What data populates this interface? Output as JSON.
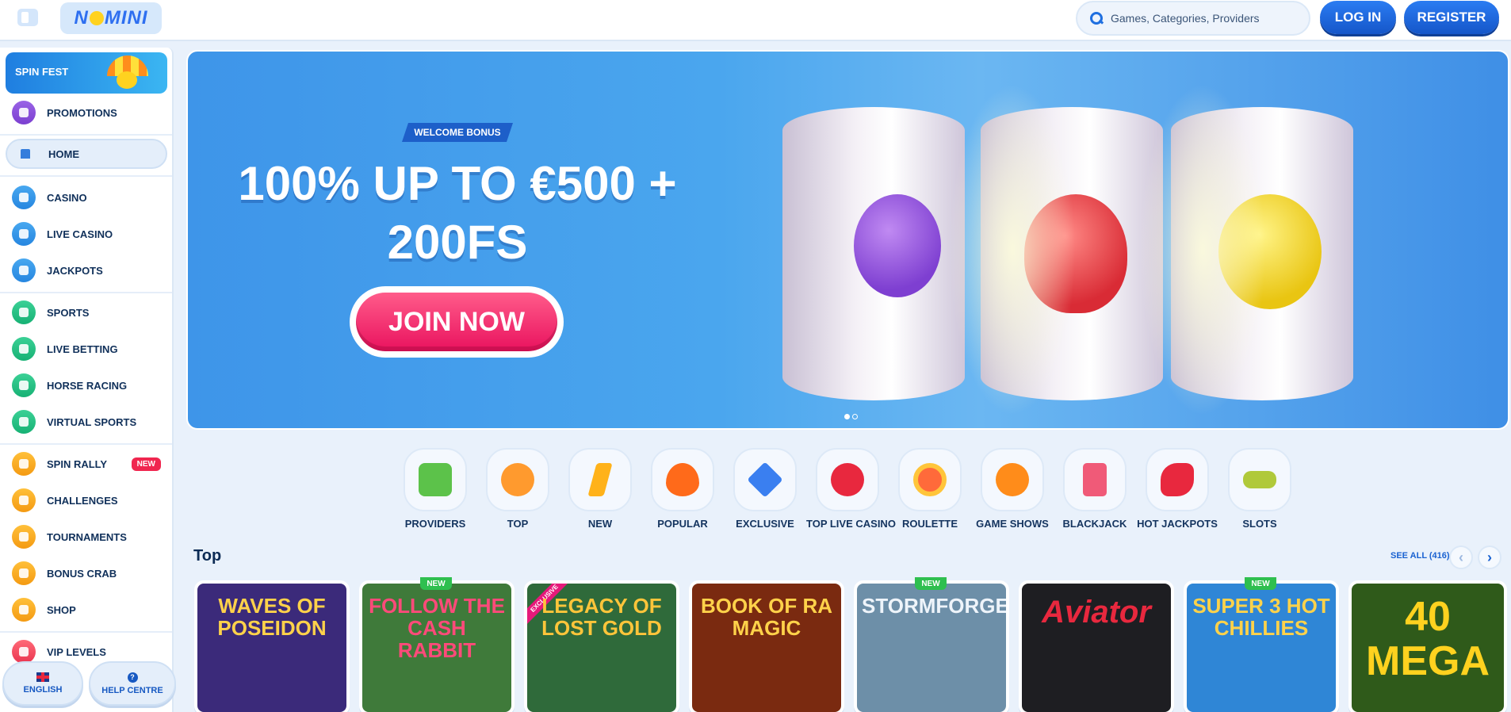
{
  "header": {
    "search_placeholder": "Games, Categories, Providers",
    "login_label": "LOG IN",
    "register_label": "REGISTER"
  },
  "sidebar": {
    "promo_label": "SPIN FEST",
    "items": [
      {
        "label": "PROMOTIONS",
        "icon": "gift-icon"
      },
      {
        "label": "HOME",
        "icon": "home-icon",
        "active": true
      },
      {
        "label": "CASINO",
        "icon": "casino-icon"
      },
      {
        "label": "LIVE CASINO",
        "icon": "live-casino-icon"
      },
      {
        "label": "JACKPOTS",
        "icon": "jackpots-icon"
      },
      {
        "label": "SPORTS",
        "icon": "sports-icon"
      },
      {
        "label": "LIVE BETTING",
        "icon": "live-betting-icon"
      },
      {
        "label": "HORSE RACING",
        "icon": "horse-racing-icon"
      },
      {
        "label": "VIRTUAL SPORTS",
        "icon": "virtual-sports-icon"
      },
      {
        "label": "SPIN RALLY",
        "icon": "spin-rally-icon",
        "badge": "NEW"
      },
      {
        "label": "CHALLENGES",
        "icon": "challenges-icon"
      },
      {
        "label": "TOURNAMENTS",
        "icon": "trophy-icon"
      },
      {
        "label": "BONUS CRAB",
        "icon": "bonus-crab-icon"
      },
      {
        "label": "SHOP",
        "icon": "shop-icon"
      },
      {
        "label": "VIP LEVELS",
        "icon": "vip-icon"
      }
    ],
    "language_label": "ENGLISH",
    "help_label": "HELP CENTRE"
  },
  "hero": {
    "badge": "WELCOME BONUS",
    "title_line1": "100% UP TO €500 +",
    "title_line2": "200FS",
    "cta": "JOIN NOW"
  },
  "categories": [
    {
      "label": "PROVIDERS",
      "icon": "book-icon",
      "color": "#5cc24a"
    },
    {
      "label": "TOP",
      "icon": "crown-icon",
      "color": "#ff9a2e"
    },
    {
      "label": "NEW",
      "icon": "lightning-icon",
      "color": "#ffb21a"
    },
    {
      "label": "POPULAR",
      "icon": "fire-icon",
      "color": "#ff6a1a"
    },
    {
      "label": "EXCLUSIVE",
      "icon": "diamond-icon",
      "color": "#3a7ff0"
    },
    {
      "label": "TOP LIVE CASINO",
      "icon": "chips-icon",
      "color": "#e8283e"
    },
    {
      "label": "ROULETTE",
      "icon": "roulette-icon",
      "color": "#ff6a3a"
    },
    {
      "label": "GAME SHOWS",
      "icon": "orange-icon",
      "color": "#ff8c1a"
    },
    {
      "label": "BLACKJACK",
      "icon": "cards-icon",
      "color": "#f05a78"
    },
    {
      "label": "HOT JACKPOTS",
      "icon": "chilli-icon",
      "color": "#e8283e"
    },
    {
      "label": "SLOTS",
      "icon": "slot-icon",
      "color": "#b0c93a"
    }
  ],
  "top_section": {
    "title": "Top",
    "see_all": "SEE ALL (416)",
    "games": [
      {
        "title": "WAVES OF POSEIDON",
        "bg": "#3b2a7a",
        "fg": "#ffd24a",
        "badge": ""
      },
      {
        "title": "FOLLOW THE CASH RABBIT",
        "bg": "#3f7a3a",
        "fg": "#ff4a7a",
        "badge": "NEW"
      },
      {
        "title": "LEGACY OF LOST GOLD",
        "bg": "#2f6a3a",
        "fg": "#ffc53a",
        "badge": "EXCLUSIVE"
      },
      {
        "title": "BOOK OF RA MAGIC",
        "bg": "#7a2a10",
        "fg": "#ffd24a",
        "badge": ""
      },
      {
        "title": "STORMFORGED",
        "bg": "#6d8fa8",
        "fg": "#eef4fa",
        "badge": "NEW"
      },
      {
        "title": "Aviator",
        "bg": "#1e1e22",
        "fg": "#e8283e",
        "badge": ""
      },
      {
        "title": "SUPER 3 HOT CHILLIES",
        "bg": "#2f86d6",
        "fg": "#ffd24a",
        "badge": "NEW"
      },
      {
        "title": "40 MEGA",
        "bg": "#2f5a1a",
        "fg": "#ffd21f",
        "badge": ""
      }
    ]
  }
}
